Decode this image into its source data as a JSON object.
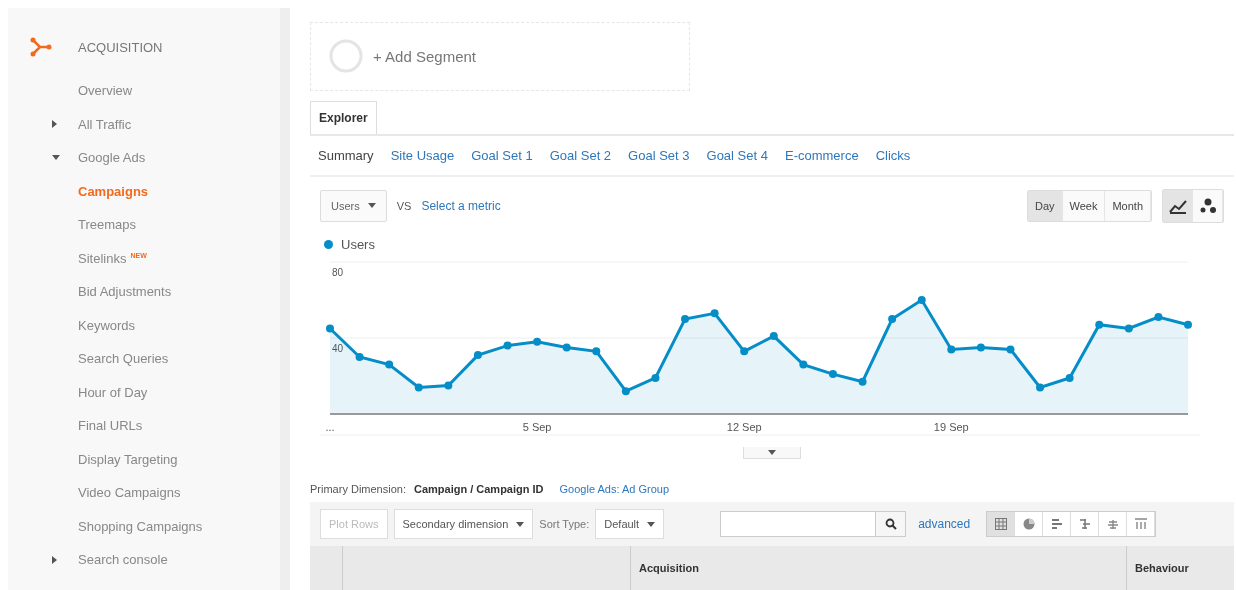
{
  "sidebar": {
    "section": {
      "title": "ACQUISITION"
    },
    "items": [
      {
        "label": "Overview",
        "selected": false
      },
      {
        "label": "All Traffic",
        "expanded": false,
        "selected": false
      },
      {
        "label": "Google Ads",
        "expanded": true,
        "selected": false,
        "children": [
          {
            "label": "Campaigns",
            "selected": true
          },
          {
            "label": "Treemaps",
            "selected": false
          },
          {
            "label": "Sitelinks",
            "badge": "NEW",
            "selected": false
          },
          {
            "label": "Bid Adjustments",
            "selected": false
          },
          {
            "label": "Keywords",
            "selected": false
          },
          {
            "label": "Search Queries",
            "selected": false
          },
          {
            "label": "Hour of Day",
            "selected": false
          },
          {
            "label": "Final URLs",
            "selected": false
          },
          {
            "label": "Display Targeting",
            "selected": false
          },
          {
            "label": "Video Campaigns",
            "selected": false
          },
          {
            "label": "Shopping Campaigns",
            "selected": false
          }
        ]
      },
      {
        "label": "Search console",
        "expanded": false,
        "selected": false
      }
    ]
  },
  "segment": {
    "label": "+ Add Segment"
  },
  "tabs": [
    {
      "label": "Explorer",
      "selected": true
    }
  ],
  "subtabs": [
    {
      "label": "Summary",
      "selected": true
    },
    {
      "label": "Site Usage",
      "selected": false
    },
    {
      "label": "Goal Set 1",
      "selected": false
    },
    {
      "label": "Goal Set 2",
      "selected": false
    },
    {
      "label": "Goal Set 3",
      "selected": false
    },
    {
      "label": "Goal Set 4",
      "selected": false
    },
    {
      "label": "E-commerce",
      "selected": false
    },
    {
      "label": "Clicks",
      "selected": false
    }
  ],
  "chart_controls": {
    "metric": "Users",
    "vs": "VS",
    "second_metric": "Select a metric",
    "periods": [
      {
        "label": "Day",
        "selected": true
      },
      {
        "label": "Week",
        "selected": false
      },
      {
        "label": "Month",
        "selected": false
      }
    ],
    "chart_types": [
      {
        "kind": "line",
        "selected": true
      },
      {
        "kind": "motion",
        "selected": false
      }
    ]
  },
  "chart": {
    "chart_data": {
      "type": "area",
      "series": [
        {
          "name": "Users",
          "color": "#058dc7",
          "values": [
            45,
            30,
            26,
            14,
            15,
            31,
            36,
            38,
            35,
            33,
            12,
            19,
            50,
            53,
            33,
            41,
            26,
            21,
            17,
            50,
            60,
            34,
            35,
            34,
            14,
            19,
            47,
            45,
            51,
            47
          ]
        }
      ],
      "categories": [
        "...",
        null,
        null,
        null,
        null,
        null,
        null,
        "5 Sep",
        null,
        null,
        null,
        null,
        null,
        null,
        "12 Sep",
        null,
        null,
        null,
        null,
        null,
        null,
        "19 Sep",
        null,
        null,
        null,
        null,
        null,
        null,
        null,
        null
      ],
      "ylim": [
        0,
        80
      ],
      "yticks": [
        40,
        80
      ]
    }
  },
  "dimension": {
    "label": "Primary Dimension:",
    "value": "Campaign / Campaign ID",
    "link": "Google Ads: Ad Group"
  },
  "toolbar": {
    "plot_rows": "Plot Rows",
    "secondary": "Secondary dimension",
    "sort_label": "Sort Type:",
    "sort_value": "Default",
    "advanced": "advanced",
    "views": [
      {
        "kind": "table",
        "selected": true
      },
      {
        "kind": "pie",
        "selected": false
      },
      {
        "kind": "bars",
        "selected": false
      },
      {
        "kind": "comparison",
        "selected": false
      },
      {
        "kind": "terms",
        "selected": false
      },
      {
        "kind": "pivot",
        "selected": false
      }
    ]
  },
  "table": {
    "columns": [
      "Acquisition",
      "Behaviour"
    ]
  }
}
